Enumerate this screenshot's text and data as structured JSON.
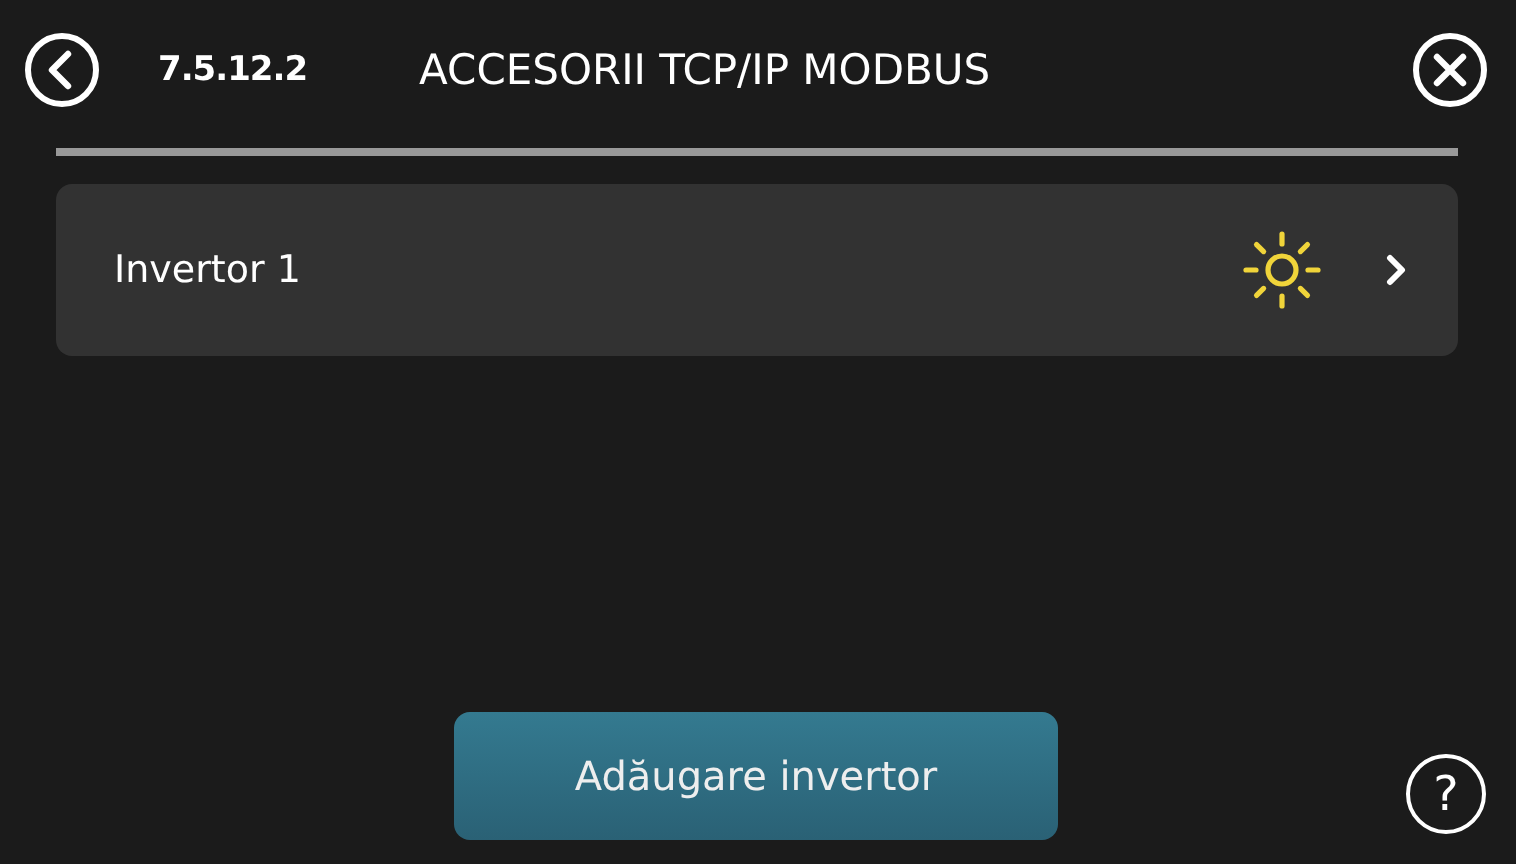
{
  "header": {
    "code": "7.5.12.2",
    "title": "ACCESORII TCP/IP MODBUS"
  },
  "items": [
    {
      "label": "Invertor 1"
    }
  ],
  "add_button": "Adăugare invertor",
  "help": "?"
}
